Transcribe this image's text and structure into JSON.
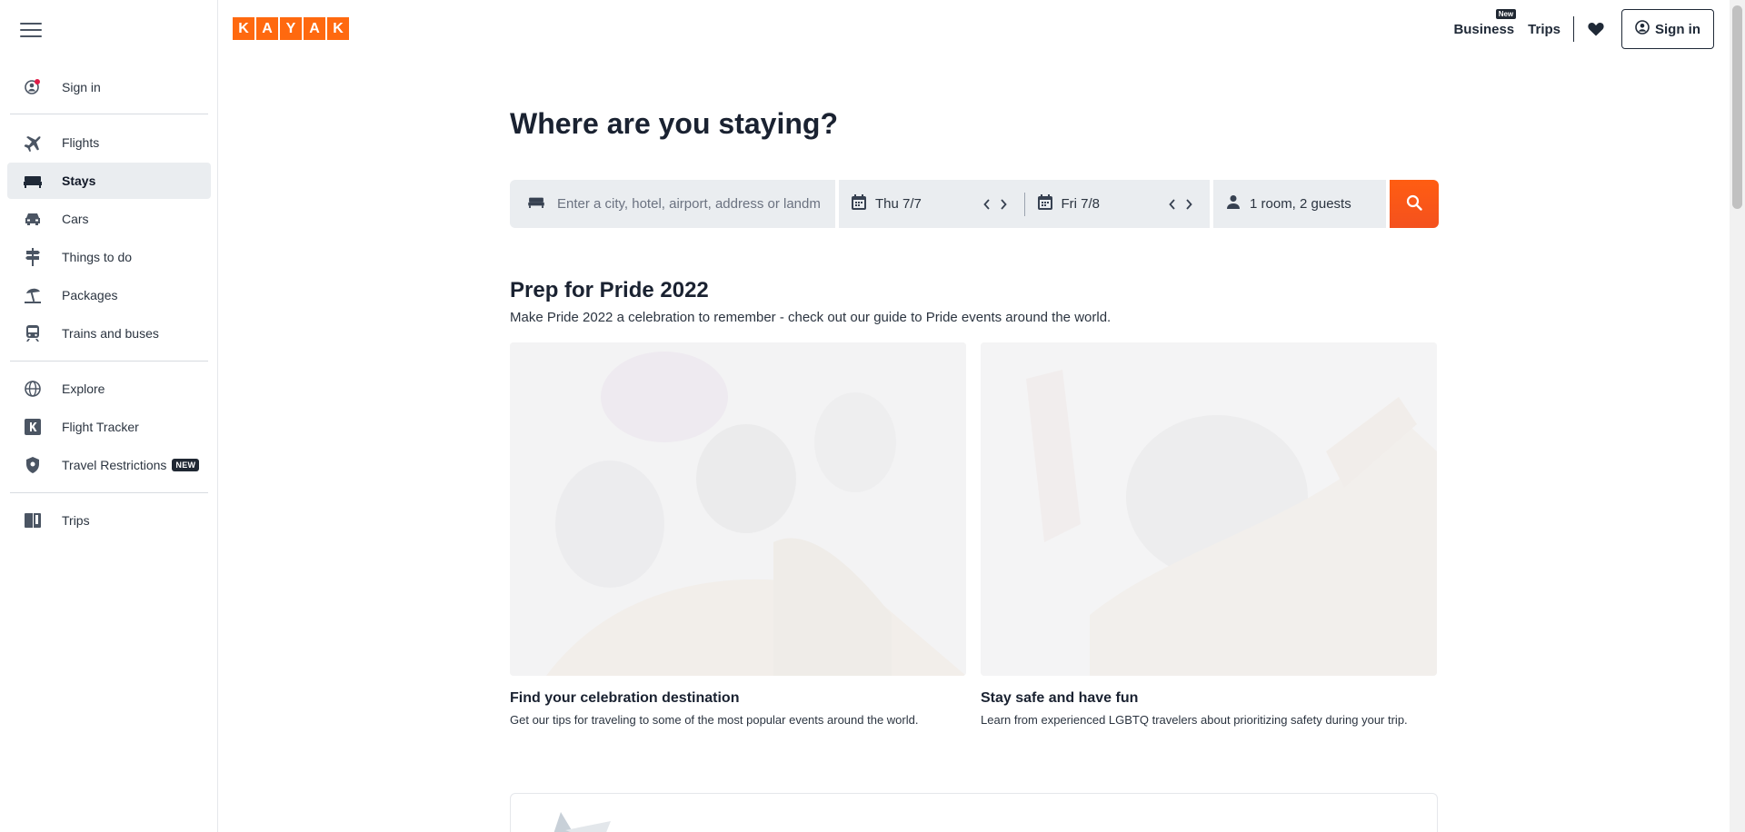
{
  "sidebar": {
    "items": [
      {
        "label": "Sign in",
        "icon": "user-circle-icon"
      },
      {
        "label": "Flights",
        "icon": "plane-icon"
      },
      {
        "label": "Stays",
        "icon": "bed-icon"
      },
      {
        "label": "Cars",
        "icon": "car-icon"
      },
      {
        "label": "Things to do",
        "icon": "signpost-icon"
      },
      {
        "label": "Packages",
        "icon": "beach-umbrella-icon"
      },
      {
        "label": "Trains and buses",
        "icon": "train-icon"
      },
      {
        "label": "Explore",
        "icon": "globe-icon"
      },
      {
        "label": "Flight Tracker",
        "icon": "kayak-k-icon"
      },
      {
        "label": "Travel Restrictions",
        "icon": "shield-icon",
        "badge": "NEW"
      },
      {
        "label": "Trips",
        "icon": "trips-book-icon"
      }
    ],
    "active": "Stays"
  },
  "header": {
    "logo_letters": [
      "K",
      "A",
      "Y",
      "A",
      "K"
    ],
    "business_label": "Business",
    "business_new": "New",
    "trips_label": "Trips",
    "signin_label": "Sign in"
  },
  "hero": {
    "title": "Where are you staying?"
  },
  "search": {
    "destination_placeholder": "Enter a city, hotel, airport, address or landmark",
    "checkin": "Thu 7/7",
    "checkout": "Fri 7/8",
    "guests": "1 room, 2 guests"
  },
  "promo": {
    "title": "Prep for Pride 2022",
    "subtitle": "Make Pride 2022 a celebration to remember - check out our guide to Pride events around the world.",
    "cards": [
      {
        "title": "Find your celebration destination",
        "desc": "Get our tips for traveling to some of the most popular events around the world."
      },
      {
        "title": "Stay safe and have fun",
        "desc": "Learn from experienced LGBTQ travelers about prioritizing safety during your trip."
      }
    ]
  },
  "colors": {
    "brand_orange": "#ff690f",
    "search_button": "#f4511e",
    "active_nav_bg": "#eaedf0"
  }
}
